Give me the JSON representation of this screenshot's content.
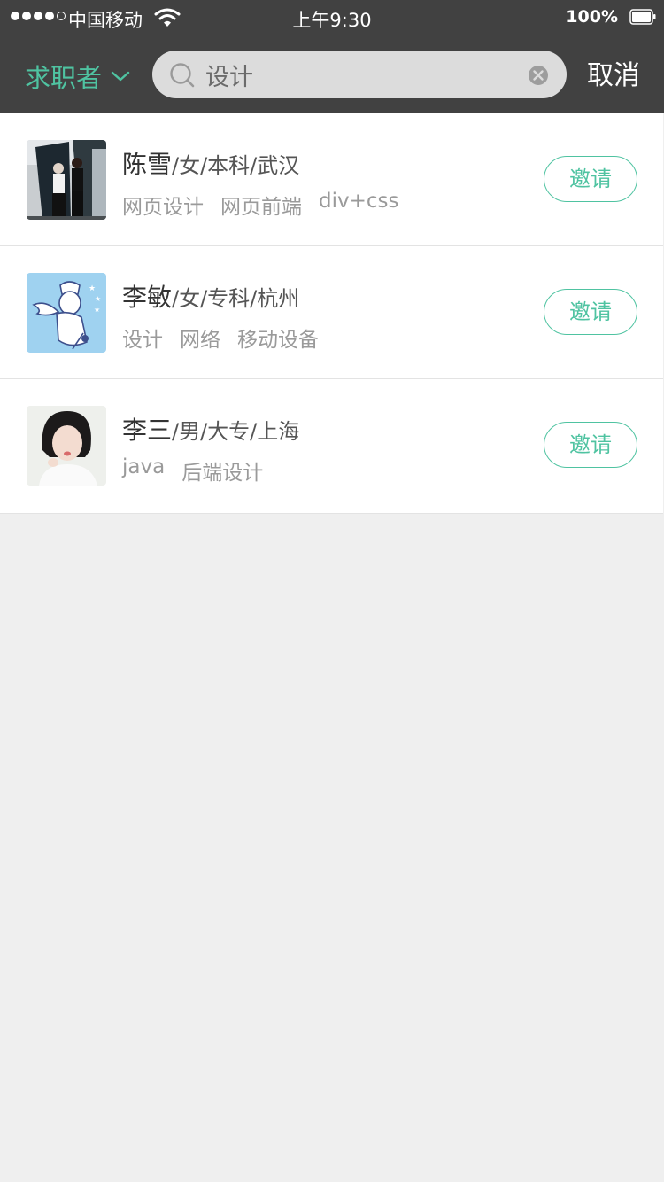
{
  "status_bar": {
    "carrier": "中国移动",
    "time": "上午9:30",
    "battery": "100%"
  },
  "header": {
    "role_filter": "求职者",
    "search_value": "设计",
    "cancel_label": "取消"
  },
  "candidates": [
    {
      "name": "陈雪",
      "details": "/女/本科/武汉",
      "tags": [
        "网页设计",
        "网页前端",
        "div+css"
      ],
      "invite_label": "邀请"
    },
    {
      "name": "李敏",
      "details": "/女/专科/杭州",
      "tags": [
        "设计",
        "网络",
        "移动设备"
      ],
      "invite_label": "邀请"
    },
    {
      "name": "李三",
      "details": "/男/大专/上海",
      "tags": [
        "java",
        "后端设计"
      ],
      "invite_label": "邀请"
    }
  ],
  "colors": {
    "accent": "#4fc3a1",
    "header_bg": "#414141",
    "page_bg": "#efefef"
  },
  "icons": {
    "role_dropdown": "chevron-down-icon",
    "search": "search-icon",
    "clear": "clear-icon",
    "wifi": "wifi-icon",
    "battery": "battery-icon"
  }
}
